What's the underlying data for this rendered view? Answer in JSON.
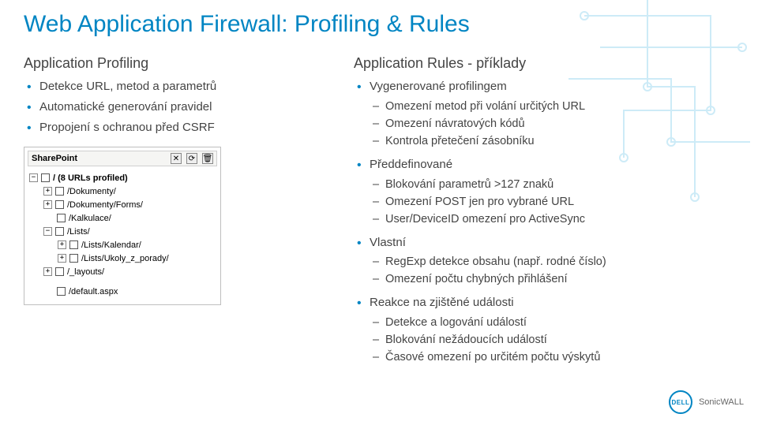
{
  "title": "Web Application Firewall: Profiling & Rules",
  "left": {
    "heading": "Application Profiling",
    "bullets": [
      "Detekce URL, metod a parametrů",
      "Automatické generování pravidel",
      "Propojení s ochranou před CSRF"
    ]
  },
  "right": {
    "heading": "Application Rules - příklady",
    "groups": [
      {
        "label": "Vygenerované profilingem",
        "items": [
          "Omezení metod při volání určitých URL",
          "Omezení návratových kódů",
          "Kontrola přetečení zásobníku"
        ]
      },
      {
        "label": "Předdefinované",
        "items": [
          "Blokování parametrů >127 znaků",
          "Omezení POST jen pro vybrané URL",
          "User/DeviceID omezení pro ActiveSync"
        ]
      },
      {
        "label": "Vlastní",
        "items": [
          "RegExp detekce obsahu (např. rodné číslo)",
          "Omezení počtu chybných přihlášení"
        ]
      },
      {
        "label": "Reakce na zjištěné události",
        "items": [
          "Detekce a logování událostí",
          "Blokování nežádoucích událostí",
          "Časové omezení po určitém počtu výskytů"
        ]
      }
    ]
  },
  "tree": {
    "app_name": "SharePoint",
    "root": {
      "expander": "−",
      "label": "/ (8 URLs profiled)"
    },
    "nodes": [
      {
        "level": 1,
        "expander": "+",
        "label": "/Dokumenty/"
      },
      {
        "level": 1,
        "expander": "+",
        "label": "/Dokumenty/Forms/"
      },
      {
        "level": 1,
        "expander": "",
        "label": "/Kalkulace/"
      },
      {
        "level": 1,
        "expander": "−",
        "label": "/Lists/"
      },
      {
        "level": 2,
        "expander": "+",
        "label": "/Lists/Kalendar/"
      },
      {
        "level": 2,
        "expander": "+",
        "label": "/Lists/Ukoly_z_porady/"
      },
      {
        "level": 1,
        "expander": "+",
        "label": "/_layouts/"
      },
      {
        "level": 1,
        "expander": "",
        "label": "/default.aspx"
      }
    ]
  },
  "brand": {
    "logo_text": "DELL",
    "subbrand": "SonicWALL"
  }
}
